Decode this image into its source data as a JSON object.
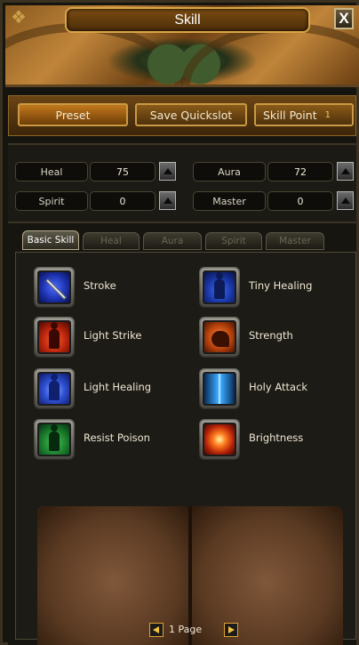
{
  "window": {
    "title": "Skill",
    "close_label": "X"
  },
  "actions": {
    "preset": "Preset",
    "save_quickslot": "Save Quickslot",
    "skill_point_label": "Skill Point",
    "skill_point_value": "1"
  },
  "stats": [
    {
      "label": "Heal",
      "value": "75"
    },
    {
      "label": "Aura",
      "value": "72"
    },
    {
      "label": "Spirit",
      "value": "0"
    },
    {
      "label": "Master",
      "value": "0"
    }
  ],
  "tabs": [
    {
      "label": "Basic Skill",
      "active": true
    },
    {
      "label": "Heal",
      "active": false
    },
    {
      "label": "Aura",
      "active": false
    },
    {
      "label": "Spirit",
      "active": false
    },
    {
      "label": "Master",
      "active": false
    }
  ],
  "skills": [
    {
      "name": "Stroke",
      "icon": "sword-icon"
    },
    {
      "name": "Tiny Healing",
      "icon": "blue-figure-icon"
    },
    {
      "name": "Light Strike",
      "icon": "red-figure-icon"
    },
    {
      "name": "Strength",
      "icon": "flexed-arm-icon"
    },
    {
      "name": "Light Healing",
      "icon": "blue-aura-figure-icon"
    },
    {
      "name": "Holy Attack",
      "icon": "light-beam-icon"
    },
    {
      "name": "Resist Poison",
      "icon": "green-figure-icon"
    },
    {
      "name": "Brightness",
      "icon": "burst-icon"
    }
  ],
  "pager": {
    "text": "1 Page"
  }
}
